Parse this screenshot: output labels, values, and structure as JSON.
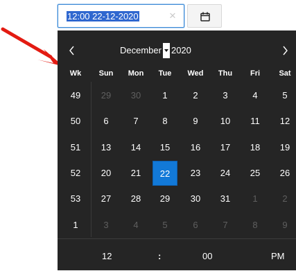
{
  "input": {
    "value": "12:00 22-12-2020",
    "clear_label": "×"
  },
  "picker": {
    "month": "December",
    "year": "2020",
    "week_header": "Wk",
    "weekdays": [
      "Sun",
      "Mon",
      "Tue",
      "Wed",
      "Thu",
      "Fri",
      "Sat"
    ],
    "week_numbers": [
      "49",
      "50",
      "51",
      "52",
      "53",
      "1"
    ],
    "dates": [
      [
        "29",
        "30",
        "1",
        "2",
        "3",
        "4",
        "5"
      ],
      [
        "6",
        "7",
        "8",
        "9",
        "10",
        "11",
        "12"
      ],
      [
        "13",
        "14",
        "15",
        "16",
        "17",
        "18",
        "19"
      ],
      [
        "20",
        "21",
        "22",
        "23",
        "24",
        "25",
        "26"
      ],
      [
        "27",
        "28",
        "29",
        "30",
        "31",
        "1",
        "2"
      ],
      [
        "3",
        "4",
        "5",
        "6",
        "7",
        "8",
        "9"
      ]
    ],
    "selected_day": "22",
    "time": {
      "hour": "12",
      "separator": ":",
      "minute": "00",
      "ampm": "PM"
    }
  },
  "colors": {
    "picker_background": "#252525",
    "selected_day_background": "#1279d8",
    "input_focus_border": "#3d8bd6",
    "arrow": "#e31b12"
  },
  "icons": {
    "calendar_button": "calendar-icon",
    "prev": "chevron-left-icon",
    "next": "chevron-right-icon",
    "clear": "close-icon",
    "arrow": "red-arrow-icon"
  }
}
